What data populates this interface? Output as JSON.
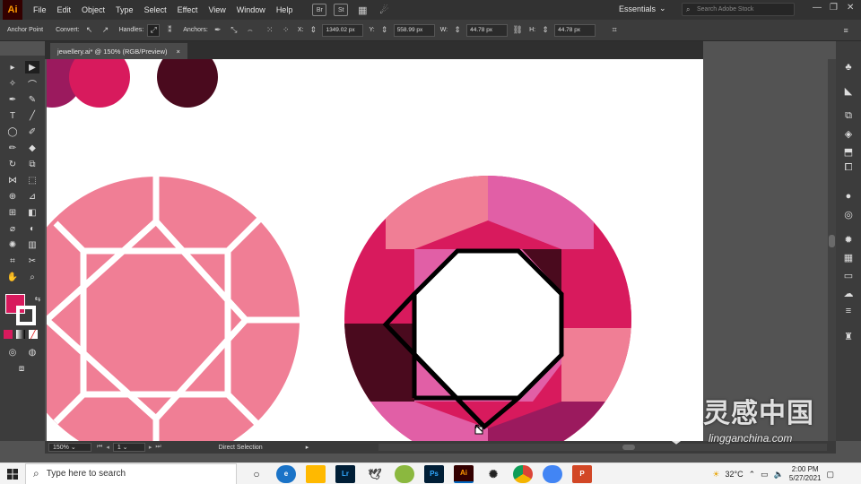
{
  "app": {
    "logo": "Ai",
    "menu": [
      "File",
      "Edit",
      "Object",
      "Type",
      "Select",
      "Effect",
      "View",
      "Window",
      "Help"
    ],
    "menu_icons": [
      "Br",
      "St"
    ],
    "workspace": "Essentials",
    "search_placeholder": "Search Adobe Stock"
  },
  "control_bar": {
    "anchor_point_label": "Anchor Point",
    "convert_label": "Convert:",
    "handles_label": "Handles:",
    "anchors_label": "Anchors:",
    "x_label": "X:",
    "x_value": "1349.02 px",
    "y_label": "Y:",
    "y_value": "558.99 px",
    "w_label": "W:",
    "w_value": "44.78 px",
    "h_label": "H:",
    "h_value": "44.78 px"
  },
  "document": {
    "tab_title": "jewellery.ai* @ 150% (RGB/Preview)",
    "tab_close": "×"
  },
  "status_bar": {
    "zoom": "150%",
    "artboard": "1",
    "tool_name": "Direct Selection"
  },
  "colors": {
    "fill": "#d81a5d",
    "swatch_pink": "#d81a5d",
    "swatch_dark": "#4a0a1e",
    "gem_pink_light": "#f07e95",
    "gem_magenta": "#d81a5d",
    "gem_orchid": "#e15fa6",
    "gem_maroon": "#4a0a1e",
    "gem_plum": "#9b1a5e"
  },
  "taskbar": {
    "search_placeholder": "Type here to search",
    "temperature": "32°C",
    "time": "2:00 PM",
    "date": "5/27/2021"
  },
  "watermark": {
    "title": "灵感中国",
    "url": "lingganchina.com"
  }
}
